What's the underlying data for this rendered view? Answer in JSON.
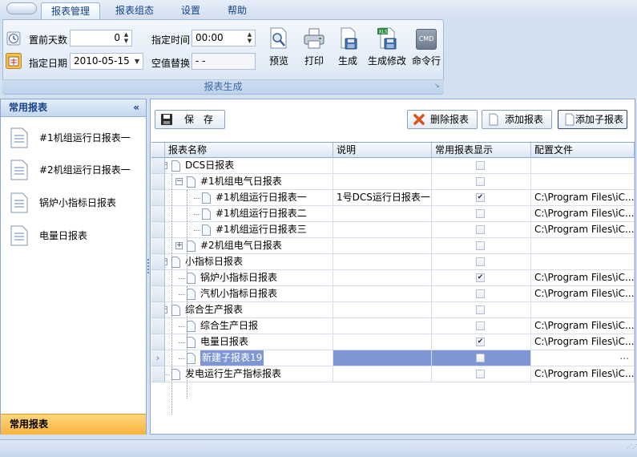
{
  "menu_tabs": [
    "报表管理",
    "报表组态",
    "设置",
    "帮助"
  ],
  "ribbon": {
    "days_before_label": "置前天数",
    "days_before_value": "0",
    "date_label": "指定日期",
    "date_value": "2010-05-15",
    "time_label": "指定时间",
    "time_value": "00:00",
    "null_replace_label": "空值替换",
    "null_replace_value": "- -",
    "buttons": [
      "预览",
      "打印",
      "生成",
      "生成修改",
      "命令行"
    ],
    "cmd_icon_text": "CMD",
    "group_title": "报表生成"
  },
  "left_panel": {
    "title": "常用报表",
    "collapse_glyph": "«",
    "items": [
      "#1机组运行日报表一",
      "#2机组运行日报表一",
      "锅炉小指标日报表",
      "电量日报表"
    ],
    "footer": "常用报表"
  },
  "toolbar": {
    "save": "保　存",
    "delete": "删除报表",
    "add": "添加报表",
    "add_child": "添加子报表"
  },
  "grid": {
    "columns": [
      "报表名称",
      "说明",
      "常用报表显示",
      "配置文件"
    ],
    "rows": [
      {
        "name": "DCS日报表",
        "desc": "",
        "checked": false,
        "config": ""
      },
      {
        "name": "#1机组电气日报表",
        "desc": "",
        "checked": false,
        "config": ""
      },
      {
        "name": "#1机组运行日报表一",
        "desc": "1号DCS运行日报表一",
        "checked": true,
        "config": "C:\\Program Files\\iC..."
      },
      {
        "name": "#1机组运行日报表二",
        "desc": "",
        "checked": false,
        "config": "C:\\Program Files\\iC..."
      },
      {
        "name": "#1机组运行日报表三",
        "desc": "",
        "checked": false,
        "config": "C:\\Program Files\\iC..."
      },
      {
        "name": "#2机组电气日报表",
        "desc": "",
        "checked": false,
        "config": ""
      },
      {
        "name": "小指标日报表",
        "desc": "",
        "checked": false,
        "config": ""
      },
      {
        "name": "锅炉小指标日报表",
        "desc": "",
        "checked": true,
        "config": "C:\\Program Files\\iC..."
      },
      {
        "name": "汽机小指标日报表",
        "desc": "",
        "checked": false,
        "config": "C:\\Program Files\\iC..."
      },
      {
        "name": "综合生产报表",
        "desc": "",
        "checked": false,
        "config": ""
      },
      {
        "name": "综合生产日报",
        "desc": "",
        "checked": false,
        "config": "C:\\Program Files\\iC..."
      },
      {
        "name": "电量日报表",
        "desc": "",
        "checked": true,
        "config": "C:\\Program Files\\iC..."
      },
      {
        "name": "新建子报表19",
        "desc": "",
        "checked": false,
        "config": ""
      },
      {
        "name": "发电运行生产指标报表",
        "desc": "",
        "checked": false,
        "config": "C:\\Program Files\\iC..."
      }
    ],
    "ellipsis": "...",
    "current_row_marker": "›"
  },
  "colors": {
    "accent": "#15428b",
    "selection": "#7d97d5",
    "footer_orange": "#f8b33d"
  },
  "icons": [
    "clock-icon",
    "calendar-icon",
    "preview-icon",
    "print-icon",
    "generate-icon",
    "generate-edit-icon",
    "cmd-icon",
    "save-icon",
    "delete-icon",
    "add-doc-icon",
    "add-child-doc-icon",
    "document-icon"
  ]
}
